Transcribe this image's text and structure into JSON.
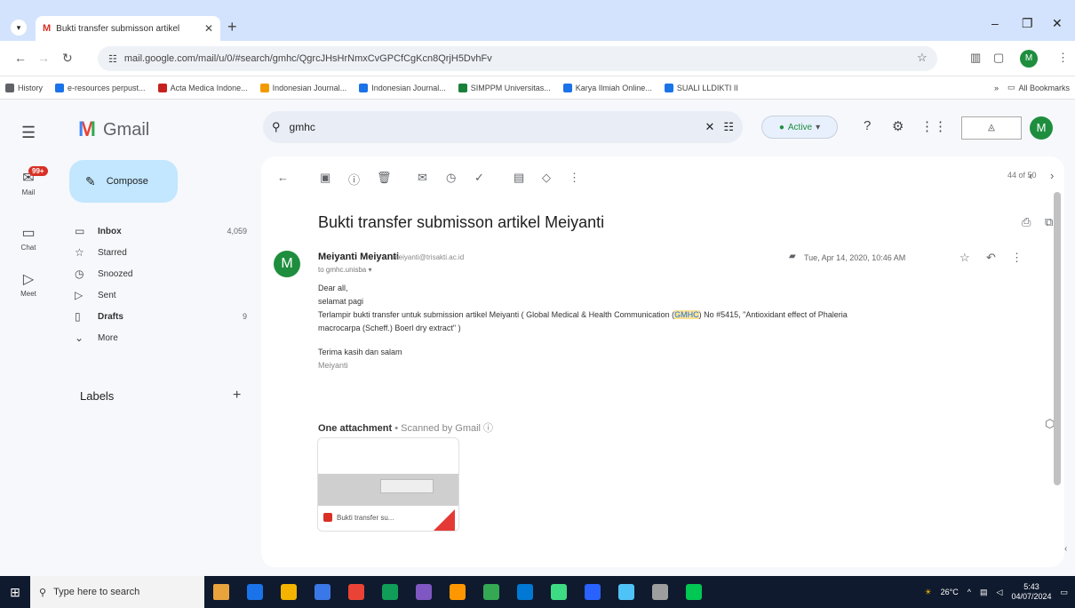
{
  "browser": {
    "tab_title": "Bukti transfer submisson artikel",
    "new_tab": "+",
    "url": "mail.google.com/mail/u/0/#search/gmhc/QgrcJHsHrNmxCvGPCfCgKcn8QrjH5DvhFv",
    "bookmarks": [
      {
        "label": "History",
        "color": "#5f6368"
      },
      {
        "label": "e-resources perpust...",
        "color": "#1a73e8"
      },
      {
        "label": "Acta Medica Indone...",
        "color": "#c5221f"
      },
      {
        "label": "Indonesian Journal...",
        "color": "#f29900"
      },
      {
        "label": "Indonesian Journal...",
        "color": "#1a73e8"
      },
      {
        "label": "SIMPPM Universitas...",
        "color": "#188038"
      },
      {
        "label": "Karya Ilmiah Online...",
        "color": "#1a73e8"
      },
      {
        "label": "SUALI LLDIKTI II",
        "color": "#1a73e8"
      }
    ],
    "all_bookmarks": "All Bookmarks"
  },
  "gmail": {
    "app_name": "Gmail",
    "search_value": "gmhc",
    "status": "Active",
    "avatar_letter": "M",
    "rail": [
      {
        "label": "Mail",
        "icon": "mail-icon"
      },
      {
        "label": "Chat",
        "icon": "chat-icon"
      },
      {
        "label": "Meet",
        "icon": "meet-icon"
      }
    ],
    "mail_badge": "99+",
    "compose": "Compose",
    "nav": [
      {
        "label": "Inbox",
        "count": "4,059",
        "icon": "inbox-icon",
        "glyph": "▭",
        "bold": true
      },
      {
        "label": "Starred",
        "count": "",
        "icon": "star-icon",
        "glyph": "☆",
        "bold": false
      },
      {
        "label": "Snoozed",
        "count": "",
        "icon": "clock-icon",
        "glyph": "◷",
        "bold": false
      },
      {
        "label": "Sent",
        "count": "",
        "icon": "send-icon",
        "glyph": "▷",
        "bold": false
      },
      {
        "label": "Drafts",
        "count": "9",
        "icon": "draft-icon",
        "glyph": "▯",
        "bold": true
      },
      {
        "label": "More",
        "count": "",
        "icon": "chevron-down-icon",
        "glyph": "⌄",
        "bold": false
      }
    ],
    "labels_heading": "Labels",
    "pager": "44 of 50",
    "email": {
      "subject": "Bukti transfer submisson artikel Meiyanti",
      "sender_name": "Meiyanti Meiyanti",
      "sender_email": "meiyanti@trisakti.ac.id",
      "sender_initial": "M",
      "to": "to gmhc.unisba",
      "date": "Tue, Apr 14, 2020, 10:46 AM",
      "greeting": "Dear all,",
      "line2": "selamat pagi",
      "line3_before": "Terlampir bukti transfer untuk submission artikel Meiyanti ( Global Medical & Health Communication (",
      "line3_highlight": "GMHC",
      "line3_after": ") No #5415, \"Antioxidant effect of Phaleria",
      "line4": "macrocarpa (Scheff.) Boerl dry extract\" )",
      "closing": "Terima kasih dan salam",
      "signature": "Meiyanti"
    },
    "attachment": {
      "title": "One attachment",
      "scanned": "• Scanned by Gmail ⓘ",
      "file_name": "Bukti transfer su..."
    }
  },
  "taskbar": {
    "search_placeholder": "Type here to search",
    "temperature": "26°C",
    "time": "5:43",
    "date": "04/07/2024",
    "apps": [
      "#e8a33d",
      "#1a73e8",
      "#f4b400",
      "#3b78e7",
      "#ea4335",
      "#0f9d58",
      "#7e57c2",
      "#ff9800",
      "#34a853",
      "#0078d4",
      "#3ddc84",
      "#2962ff",
      "#4fc3f7",
      "#9e9e9e",
      "#00c853"
    ]
  }
}
